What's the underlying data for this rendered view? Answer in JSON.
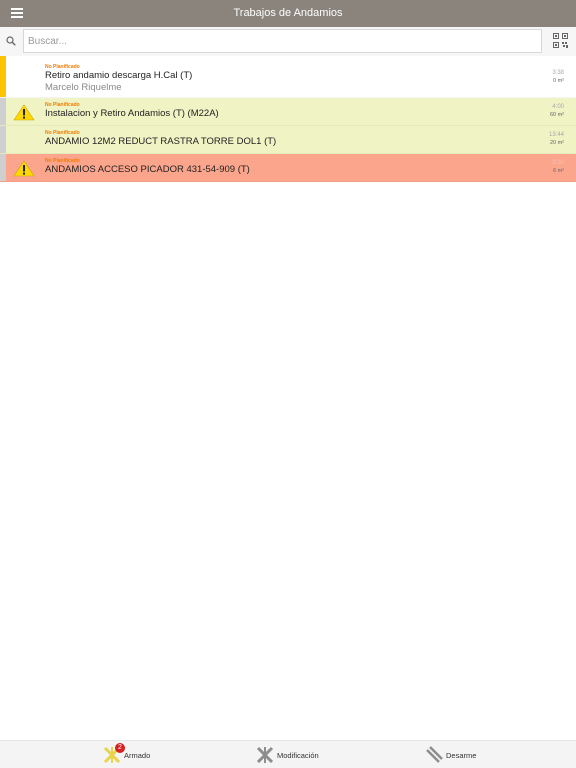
{
  "header": {
    "title": "Trabajos de Andamios"
  },
  "search": {
    "placeholder": "Buscar..."
  },
  "colors": {
    "header": "#8a847c",
    "row_yellow": "#f0f3c4",
    "row_red": "#fba58c",
    "accent_orange": "#f07c00",
    "bar_yellow": "#ffc400"
  },
  "jobs": [
    {
      "tag": "No Planificado",
      "name": "Retiro andamio descarga H.Cal (T)",
      "person": "Marcelo Riquelme",
      "time": "3:38",
      "qty": "0 m²",
      "icon": "none"
    },
    {
      "tag": "No Planificado",
      "name": "Instalacion y Retiro Andamios (T) (M22A)",
      "time": "4:00",
      "qty": "60 m²",
      "icon": "warning-icon"
    },
    {
      "tag": "No Planificado",
      "name": "ANDAMIO 12M2 REDUCT RASTRA TORRE DOL1 (T)",
      "time": "13:44",
      "qty": "20 m²",
      "icon": "none"
    },
    {
      "tag": "No Planificado",
      "name": "ANDAMIOS ACCESO PICADOR  431-54-909 (T)",
      "time": "3:30",
      "qty": "6 m²",
      "icon": "warning-icon"
    }
  ],
  "tabs": [
    {
      "label": "Armado",
      "badge": "2",
      "icon": "armado-icon"
    },
    {
      "label": "Modificación",
      "icon": "modificacion-icon"
    },
    {
      "label": "Desarme",
      "icon": "desarme-icon"
    }
  ]
}
